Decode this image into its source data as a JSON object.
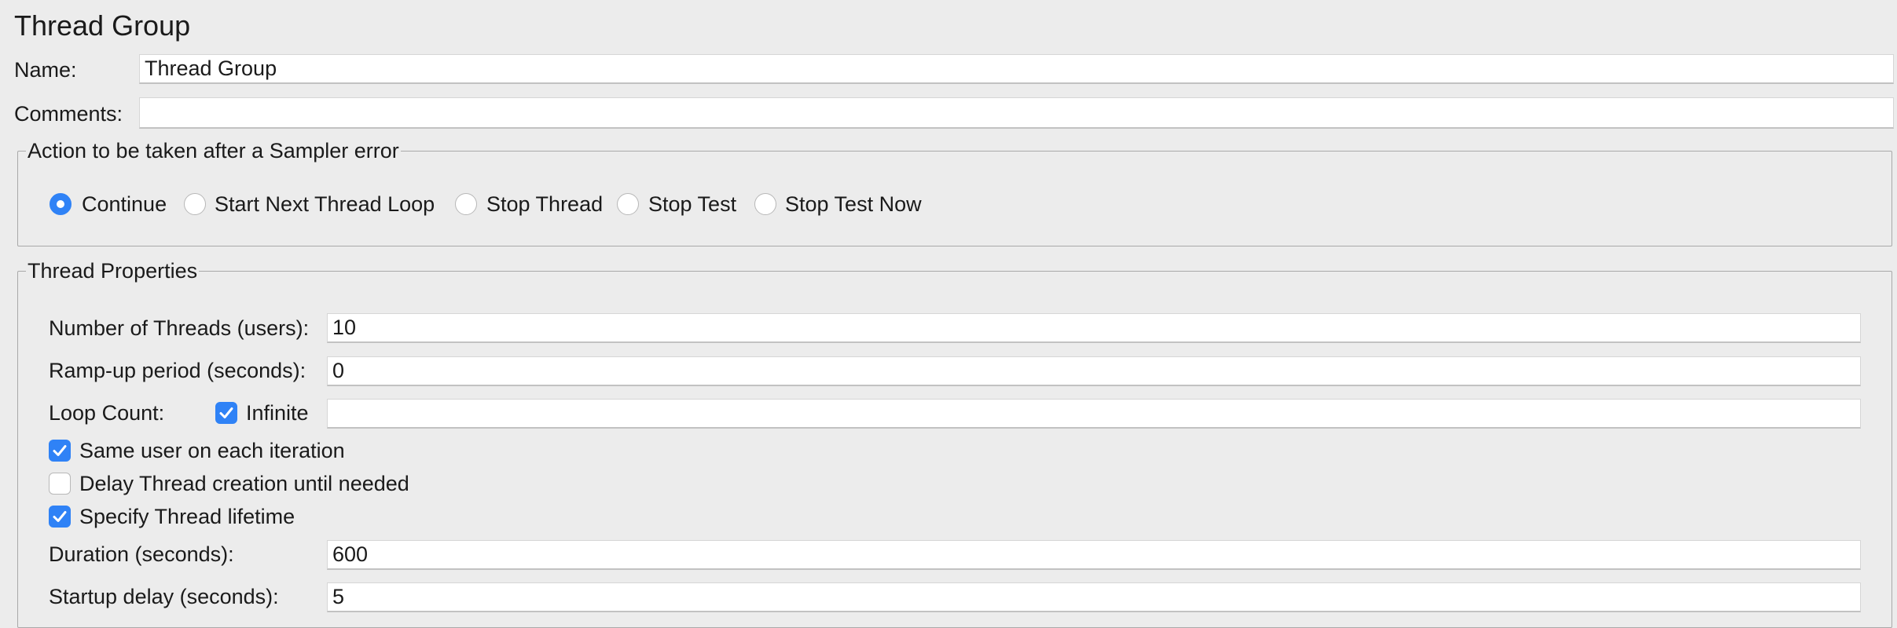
{
  "panel": {
    "title": "Thread Group"
  },
  "name_field": {
    "label": "Name:",
    "value": "Thread Group"
  },
  "comments_field": {
    "label": "Comments:",
    "value": ""
  },
  "sampler_error": {
    "legend": "Action to be taken after a Sampler error",
    "selected": "Continue",
    "options": [
      "Continue",
      "Start Next Thread Loop",
      "Stop Thread",
      "Stop Test",
      "Stop Test Now"
    ]
  },
  "thread_properties": {
    "legend": "Thread Properties",
    "num_threads": {
      "label": "Number of Threads (users):",
      "value": "10"
    },
    "ramp_up": {
      "label": "Ramp-up period (seconds):",
      "value": "0"
    },
    "loop_count": {
      "label": "Loop Count:",
      "infinite_label": "Infinite",
      "infinite_checked": true,
      "value": ""
    },
    "same_user": {
      "label": "Same user on each iteration",
      "checked": true
    },
    "delay_creation": {
      "label": "Delay Thread creation until needed",
      "checked": false
    },
    "specify_lifetime": {
      "label": "Specify Thread lifetime",
      "checked": true
    },
    "duration": {
      "label": "Duration (seconds):",
      "value": "600"
    },
    "startup_delay": {
      "label": "Startup delay (seconds):",
      "value": "5"
    }
  },
  "colors": {
    "accent": "#2f82f6",
    "background": "#ececec",
    "field": "#ffffff",
    "border": "#a9a9a9"
  }
}
